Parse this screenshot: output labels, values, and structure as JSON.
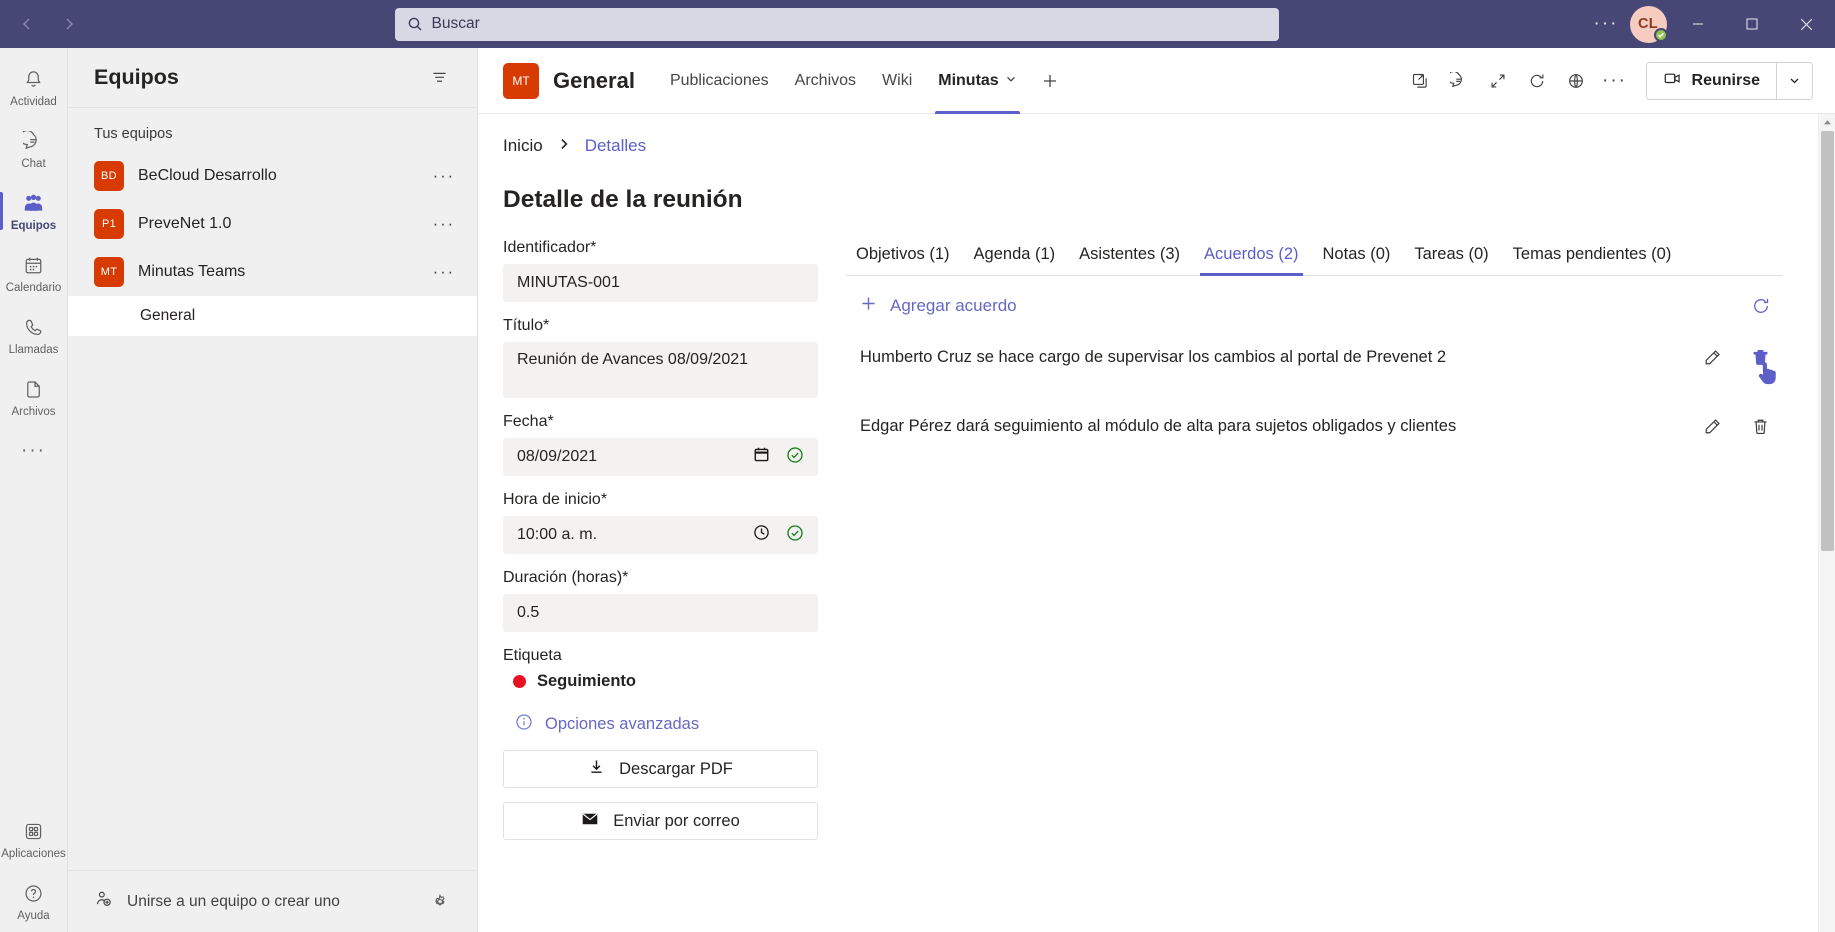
{
  "titlebar": {
    "back_icon": "chevron-left-icon",
    "forward_icon": "chevron-right-icon",
    "search_placeholder": "Buscar",
    "more_label": "···",
    "avatar_initials": "CL",
    "presence_status": "available",
    "accent_color": "#464775"
  },
  "rail": {
    "items": [
      {
        "label": "Actividad",
        "icon": "bell-icon",
        "active": false
      },
      {
        "label": "Chat",
        "icon": "chat-icon",
        "active": false
      },
      {
        "label": "Equipos",
        "icon": "teams-icon",
        "active": true
      },
      {
        "label": "Calendario",
        "icon": "calendar-icon",
        "active": false
      },
      {
        "label": "Llamadas",
        "icon": "phone-icon",
        "active": false
      },
      {
        "label": "Archivos",
        "icon": "file-icon",
        "active": false
      }
    ],
    "more_label": "···",
    "bottom": [
      {
        "label": "Aplicaciones",
        "icon": "apps-grid-icon"
      },
      {
        "label": "Ayuda",
        "icon": "help-circle-icon"
      }
    ]
  },
  "teams_panel": {
    "header": "Equipos",
    "filter_icon": "filter-icon",
    "section_label": "Tus equipos",
    "teams": [
      {
        "initials": "BD",
        "name": "BeCloud Desarrollo",
        "color": "#d83b01",
        "more": "···"
      },
      {
        "initials": "P1",
        "name": "PreveNet 1.0",
        "color": "#d83b01",
        "more": "···"
      },
      {
        "initials": "MT",
        "name": "Minutas Teams",
        "color": "#d83b01",
        "more": "···"
      }
    ],
    "channels": [
      {
        "name": "General",
        "active": true
      }
    ],
    "footer_label": "Unirse a un equipo o crear uno",
    "footer_icon": "add-people-icon",
    "gear_icon": "gear-icon"
  },
  "channel_header": {
    "avatar_initials": "MT",
    "title": "General",
    "tabs": [
      {
        "label": "Publicaciones",
        "active": false,
        "has_chevron": false
      },
      {
        "label": "Archivos",
        "active": false,
        "has_chevron": false
      },
      {
        "label": "Wiki",
        "active": false,
        "has_chevron": false
      },
      {
        "label": "Minutas",
        "active": true,
        "has_chevron": true
      }
    ],
    "add_tab_icon": "plus-icon",
    "actions": [
      {
        "icon": "open-in-new-window-icon"
      },
      {
        "icon": "conversation-icon"
      },
      {
        "icon": "expand-icon"
      },
      {
        "icon": "refresh-icon"
      },
      {
        "icon": "globe-icon"
      }
    ],
    "more_label": "···",
    "meet_label": "Reunirse",
    "meet_icon": "video-camera-icon",
    "meet_caret_icon": "chevron-down-icon"
  },
  "breadcrumb": {
    "home": "Inicio",
    "separator_icon": "chevron-right-icon",
    "current": "Detalles"
  },
  "page": {
    "title": "Detalle de la reunión"
  },
  "form": {
    "identificador": {
      "label": "Identificador*",
      "value": "MINUTAS-001"
    },
    "titulo": {
      "label": "Título*",
      "value": "Reunión  de Avances 08/09/2021"
    },
    "fecha": {
      "label": "Fecha*",
      "value": "08/09/2021",
      "icon": "calendar-icon",
      "status_icon": "check-circle-icon"
    },
    "hora": {
      "label": "Hora de inicio*",
      "value": "10:00  a. m.",
      "icon": "clock-icon",
      "status_icon": "check-circle-icon"
    },
    "duracion": {
      "label": "Duración (horas)*",
      "value": "0.5"
    },
    "etiqueta": {
      "label": "Etiqueta",
      "value": "Seguimiento",
      "color": "#e81123"
    },
    "advanced": {
      "label": "Opciones avanzadas",
      "icon": "info-icon"
    },
    "buttons": [
      {
        "label": "Descargar PDF",
        "icon": "download-icon"
      },
      {
        "label": "Enviar por correo",
        "icon": "mail-icon"
      }
    ]
  },
  "detail": {
    "tabs": [
      {
        "label": "Objetivos (1)",
        "active": false
      },
      {
        "label": "Agenda (1)",
        "active": false
      },
      {
        "label": "Asistentes (3)",
        "active": false
      },
      {
        "label": "Acuerdos (2)",
        "active": true
      },
      {
        "label": "Notas (0)",
        "active": false
      },
      {
        "label": "Tareas (0)",
        "active": false
      },
      {
        "label": "Temas pendientes (0)",
        "active": false
      }
    ],
    "add_label": "Agregar acuerdo",
    "add_icon": "plus-icon",
    "refresh_icon": "refresh-icon",
    "rows": [
      {
        "text": "Humberto Cruz se hace cargo de supervisar los cambios al portal de Prevenet 2",
        "edit_icon": "pencil-icon",
        "delete_icon": "trash-icon",
        "delete_hovered": true
      },
      {
        "text": "Edgar Pérez dará seguimiento al módulo de alta para sujetos obligados y clientes",
        "edit_icon": "pencil-icon",
        "delete_icon": "trash-icon",
        "delete_hovered": false
      }
    ]
  },
  "scrollbar": {
    "up_arrow_icon": "caret-up-icon"
  }
}
